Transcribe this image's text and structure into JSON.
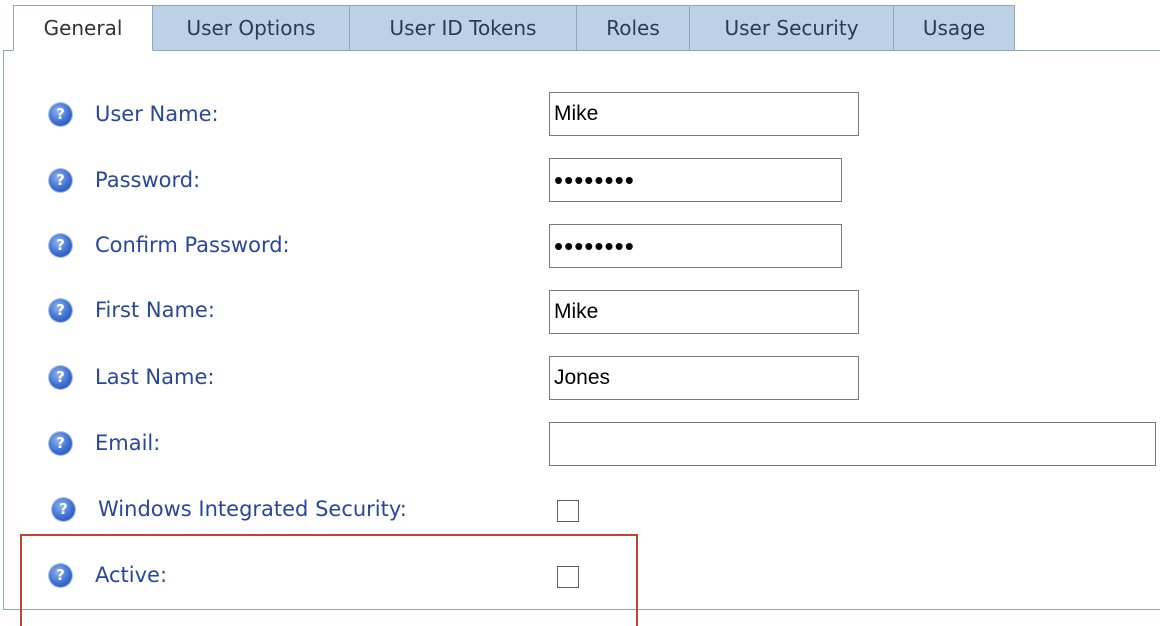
{
  "tabs": [
    {
      "label": "General",
      "active": true
    },
    {
      "label": "User Options",
      "active": false
    },
    {
      "label": "User ID Tokens",
      "active": false
    },
    {
      "label": "Roles",
      "active": false
    },
    {
      "label": "User Security",
      "active": false
    },
    {
      "label": "Usage",
      "active": false
    }
  ],
  "form": {
    "user_name": {
      "label": "User Name:",
      "value": "Mike"
    },
    "password": {
      "label": "Password:",
      "value": "••••••••"
    },
    "confirm_password": {
      "label": "Confirm Password:",
      "value": "••••••••"
    },
    "first_name": {
      "label": "First Name:",
      "value": "Mike"
    },
    "last_name": {
      "label": "Last Name:",
      "value": "Jones"
    },
    "email": {
      "label": "Email:",
      "value": ""
    },
    "windows_integrated_security": {
      "label": "Windows Integrated Security:",
      "checked": false
    },
    "active": {
      "label": "Active:",
      "checked": false
    }
  },
  "icons": {
    "help": "help-question-icon",
    "help_glyph": "?"
  },
  "colors": {
    "label": "#28479c",
    "tab_inactive_bg": "#bcd0e6",
    "highlight_border": "#c0472f"
  }
}
